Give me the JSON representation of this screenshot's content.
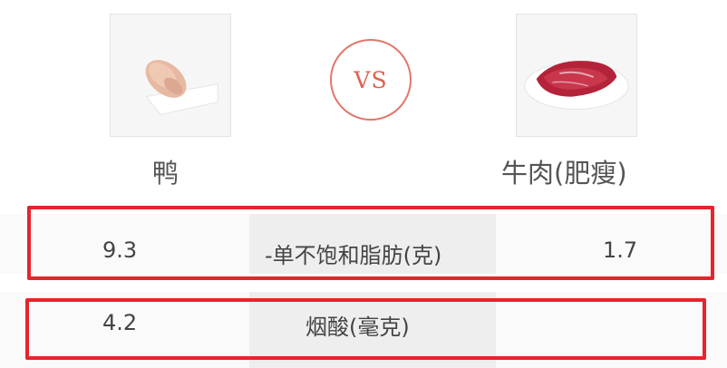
{
  "header": {
    "vs_label": "VS",
    "left_food": {
      "name": "鸭",
      "image": "duck-meat-photo"
    },
    "right_food": {
      "name": "牛肉(肥瘦)",
      "image": "beef-photo"
    }
  },
  "rows": [
    {
      "left_value": "9.3",
      "nutrient": "-单不饱和脂肪(克)",
      "right_value": "1.7"
    },
    {
      "left_value": "4.2",
      "nutrient": "烟酸(毫克)",
      "right_value": ""
    }
  ],
  "colors": {
    "highlight": "#e8232b",
    "vs_accent": "#e1614f",
    "row_bg": "#fafafa",
    "mid_cell_bg": "#eeeeee"
  }
}
